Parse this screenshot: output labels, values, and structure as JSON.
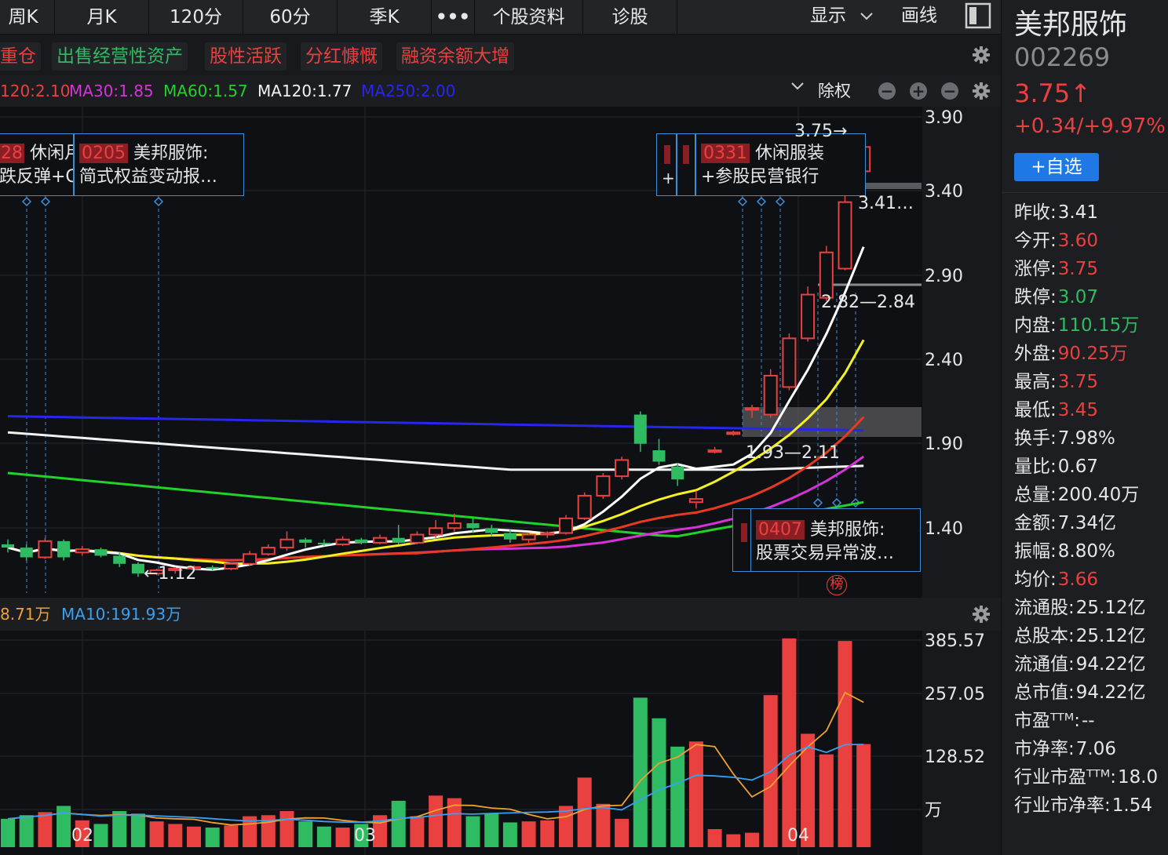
{
  "toolbar": {
    "buttons": [
      "周K",
      "月K",
      "120分",
      "60分",
      "季K",
      "•••",
      "个股资料",
      "诊股"
    ],
    "display_label": "显示",
    "draw_label": "画线"
  },
  "tags": [
    "重仓",
    "出售经营性资产",
    "股性活跃",
    "分红慷慨",
    "融资余额大增"
  ],
  "ma_row": {
    "items": [
      {
        "label": "120:2.10",
        "color": "#e8413f"
      },
      {
        "label": "MA30:1.85",
        "color": "#d633d6"
      },
      {
        "label": "MA60:1.57",
        "color": "#22d12a"
      },
      {
        "label": "MA120:1.77",
        "color": "#f2f2f2"
      },
      {
        "label": "MA250:2.00",
        "color": "#2626ee"
      }
    ],
    "adjust_label": "除权"
  },
  "price_axis": [
    "3.90",
    "3.40",
    "2.90",
    "2.40",
    "1.90",
    "1.40"
  ],
  "annotations": {
    "high_label": "3.75",
    "right_mid_label": "3.41…",
    "gap_label_1": "2.82—2.84",
    "gap_label_2": "1.93—2.11",
    "low_label": "←1.12",
    "rank_badge": "榜"
  },
  "news_boxes": [
    {
      "code": "28",
      "title": "休闲月",
      "line2": "跌反弹+C"
    },
    {
      "code": "0205",
      "title": "美邦服饰:",
      "line2": "简式权益变动报…"
    },
    {
      "code": "0331",
      "title": "休闲服装",
      "line2": "+参股民营银行"
    },
    {
      "code": "0407",
      "title": "美邦服饰:",
      "line2": "股票交易异常波…"
    }
  ],
  "volume_header": {
    "ma5": "8.71万",
    "ma10": "MA10:191.93万"
  },
  "volume_axis": [
    "385.57",
    "257.05",
    "128.52",
    "万"
  ],
  "date_axis": [
    "02",
    "03",
    "04"
  ],
  "stock": {
    "name": "美邦服饰",
    "code": "002269",
    "price": "3.75↑",
    "change": "+0.34/+9.97%",
    "watch_button": "+自选"
  },
  "stats": [
    {
      "label": "昨收:",
      "value": "3.41",
      "color": "white"
    },
    {
      "label": "今开:",
      "value": "3.60",
      "color": "red"
    },
    {
      "label": "涨停:",
      "value": "3.75",
      "color": "red"
    },
    {
      "label": "跌停:",
      "value": "3.07",
      "color": "green"
    },
    {
      "label": "内盘:",
      "value": "110.15万",
      "color": "green"
    },
    {
      "label": "外盘:",
      "value": "90.25万",
      "color": "red"
    },
    {
      "label": "最高:",
      "value": "3.75",
      "color": "red"
    },
    {
      "label": "最低:",
      "value": "3.45",
      "color": "red"
    },
    {
      "label": "换手:",
      "value": "7.98%",
      "color": "white"
    },
    {
      "label": "量比:",
      "value": "0.67",
      "color": "white"
    },
    {
      "label": "总量:",
      "value": "200.40万",
      "color": "white"
    },
    {
      "label": "金额:",
      "value": "7.34亿",
      "color": "white"
    },
    {
      "label": "振幅:",
      "value": "8.80%",
      "color": "white"
    },
    {
      "label": "均价:",
      "value": "3.66",
      "color": "red"
    },
    {
      "label": "流通股:",
      "value": "25.12亿",
      "color": "white"
    },
    {
      "label": "总股本:",
      "value": "25.12亿",
      "color": "white"
    },
    {
      "label": "流通值:",
      "value": "94.22亿",
      "color": "white"
    },
    {
      "label": "总市值:",
      "value": "94.22亿",
      "color": "white"
    },
    {
      "label": "市盈ᵀᵀᴹ:",
      "value": "--",
      "color": "white"
    },
    {
      "label": "市净率:",
      "value": "7.06",
      "color": "white"
    },
    {
      "label": "行业市盈ᵀᵀᴹ:",
      "value": "18.0",
      "color": "white"
    },
    {
      "label": "行业市净率:",
      "value": "1.54",
      "color": "white"
    }
  ],
  "colors": {
    "up": "#e8413f",
    "down": "#2fbb62",
    "accent_blue": "#1e78e6"
  },
  "chart_data": {
    "type": "candlestick",
    "y_range": [
      1.0,
      3.95
    ],
    "volume_range": [
      0,
      420
    ],
    "candles": [
      {
        "o": 1.3,
        "c": 1.28,
        "h": 1.33,
        "l": 1.25,
        "v": 55
      },
      {
        "o": 1.28,
        "c": 1.22,
        "h": 1.3,
        "l": 1.2,
        "v": 62
      },
      {
        "o": 1.22,
        "c": 1.32,
        "h": 1.34,
        "l": 1.21,
        "v": 68
      },
      {
        "o": 1.32,
        "c": 1.22,
        "h": 1.33,
        "l": 1.2,
        "v": 80
      },
      {
        "o": 1.25,
        "c": 1.27,
        "h": 1.29,
        "l": 1.23,
        "v": 52
      },
      {
        "o": 1.27,
        "c": 1.23,
        "h": 1.28,
        "l": 1.22,
        "v": 45
      },
      {
        "o": 1.23,
        "c": 1.18,
        "h": 1.25,
        "l": 1.16,
        "v": 70
      },
      {
        "o": 1.18,
        "c": 1.12,
        "h": 1.19,
        "l": 1.1,
        "v": 65
      },
      {
        "o": 1.12,
        "c": 1.14,
        "h": 1.15,
        "l": 1.11,
        "v": 50
      },
      {
        "o": 1.14,
        "c": 1.15,
        "h": 1.16,
        "l": 1.12,
        "v": 45
      },
      {
        "o": 1.15,
        "c": 1.16,
        "h": 1.17,
        "l": 1.14,
        "v": 40
      },
      {
        "o": 1.16,
        "c": 1.15,
        "h": 1.17,
        "l": 1.14,
        "v": 38
      },
      {
        "o": 1.15,
        "c": 1.18,
        "h": 1.19,
        "l": 1.14,
        "v": 42
      },
      {
        "o": 1.18,
        "c": 1.24,
        "h": 1.26,
        "l": 1.17,
        "v": 60
      },
      {
        "o": 1.24,
        "c": 1.28,
        "h": 1.3,
        "l": 1.23,
        "v": 62
      },
      {
        "o": 1.28,
        "c": 1.33,
        "h": 1.38,
        "l": 1.26,
        "v": 70
      },
      {
        "o": 1.33,
        "c": 1.31,
        "h": 1.34,
        "l": 1.28,
        "v": 50
      },
      {
        "o": 1.31,
        "c": 1.3,
        "h": 1.33,
        "l": 1.29,
        "v": 40
      },
      {
        "o": 1.3,
        "c": 1.33,
        "h": 1.35,
        "l": 1.29,
        "v": 38
      },
      {
        "o": 1.33,
        "c": 1.31,
        "h": 1.34,
        "l": 1.3,
        "v": 45
      },
      {
        "o": 1.31,
        "c": 1.34,
        "h": 1.36,
        "l": 1.3,
        "v": 62
      },
      {
        "o": 1.34,
        "c": 1.31,
        "h": 1.42,
        "l": 1.3,
        "v": 90
      },
      {
        "o": 1.31,
        "c": 1.36,
        "h": 1.38,
        "l": 1.3,
        "v": 60
      },
      {
        "o": 1.36,
        "c": 1.4,
        "h": 1.45,
        "l": 1.34,
        "v": 100
      },
      {
        "o": 1.4,
        "c": 1.43,
        "h": 1.49,
        "l": 1.38,
        "v": 95
      },
      {
        "o": 1.43,
        "c": 1.4,
        "h": 1.46,
        "l": 1.37,
        "v": 60
      },
      {
        "o": 1.4,
        "c": 1.37,
        "h": 1.42,
        "l": 1.35,
        "v": 65
      },
      {
        "o": 1.37,
        "c": 1.33,
        "h": 1.39,
        "l": 1.31,
        "v": 48
      },
      {
        "o": 1.33,
        "c": 1.36,
        "h": 1.37,
        "l": 1.31,
        "v": 50
      },
      {
        "o": 1.36,
        "c": 1.37,
        "h": 1.38,
        "l": 1.34,
        "v": 52
      },
      {
        "o": 1.37,
        "c": 1.46,
        "h": 1.48,
        "l": 1.36,
        "v": 80
      },
      {
        "o": 1.46,
        "c": 1.6,
        "h": 1.62,
        "l": 1.45,
        "v": 135
      },
      {
        "o": 1.6,
        "c": 1.72,
        "h": 1.74,
        "l": 1.58,
        "v": 84
      },
      {
        "o": 1.72,
        "c": 1.82,
        "h": 1.84,
        "l": 1.7,
        "v": 55
      },
      {
        "o": 2.1,
        "c": 1.92,
        "h": 2.12,
        "l": 1.87,
        "v": 290
      },
      {
        "o": 1.88,
        "c": 1.81,
        "h": 1.95,
        "l": 1.79,
        "v": 250
      },
      {
        "o": 1.78,
        "c": 1.7,
        "h": 1.8,
        "l": 1.66,
        "v": 195
      },
      {
        "o": 1.56,
        "c": 1.58,
        "h": 1.63,
        "l": 1.52,
        "v": 205
      },
      {
        "o": 1.87,
        "c": 1.88,
        "h": 1.9,
        "l": 1.86,
        "v": 35
      },
      {
        "o": 1.98,
        "c": 1.99,
        "h": 2.0,
        "l": 1.97,
        "v": 25
      },
      {
        "o": 2.13,
        "c": 2.14,
        "h": 2.16,
        "l": 2.08,
        "v": 28
      },
      {
        "o": 2.1,
        "c": 2.34,
        "h": 2.38,
        "l": 2.08,
        "v": 295
      },
      {
        "o": 2.27,
        "c": 2.57,
        "h": 2.6,
        "l": 2.25,
        "v": 405
      },
      {
        "o": 2.57,
        "c": 2.84,
        "h": 2.89,
        "l": 2.55,
        "v": 220
      },
      {
        "o": 2.82,
        "c": 3.1,
        "h": 3.14,
        "l": 2.8,
        "v": 180
      },
      {
        "o": 3.0,
        "c": 3.41,
        "h": 3.45,
        "l": 2.99,
        "v": 400
      },
      {
        "o": 3.6,
        "c": 3.75,
        "h": 3.75,
        "l": 3.45,
        "v": 200
      }
    ]
  }
}
